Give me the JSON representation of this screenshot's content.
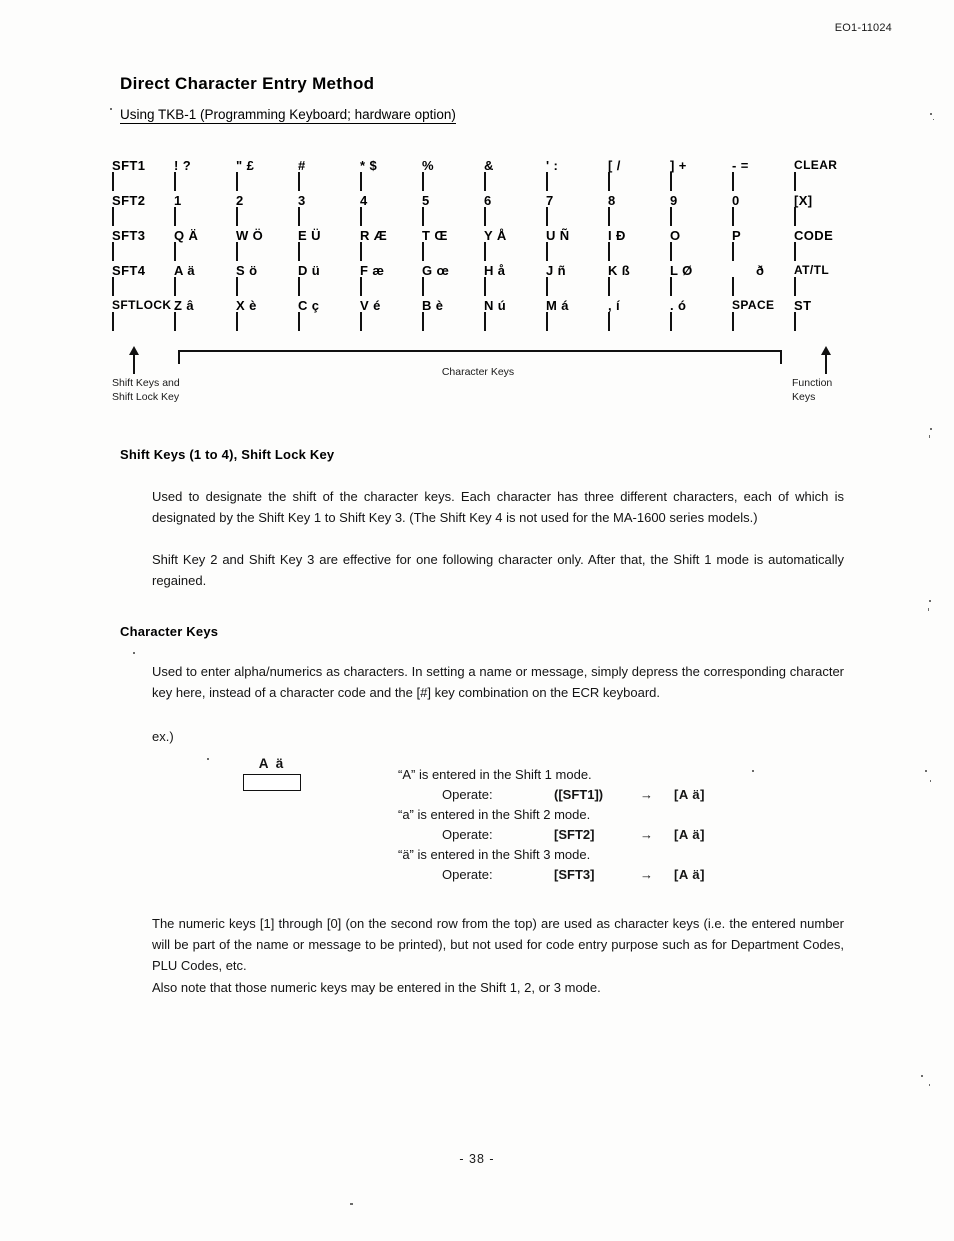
{
  "header": {
    "doc_code": "EO1-11024"
  },
  "titles": {
    "main": "Direct Character Entry Method",
    "sub": "Using TKB-1 (Programming Keyboard; hardware option)"
  },
  "keyboard": {
    "rows": [
      {
        "shift": "SFT1",
        "chars": [
          "! ?",
          "\" £",
          "#",
          "* $",
          "%",
          "&",
          "' :",
          "[ /",
          "] +",
          "- ="
        ],
        "fn": "CLEAR"
      },
      {
        "shift": "SFT2",
        "chars": [
          "1",
          "2",
          "3",
          "4",
          "5",
          "6",
          "7",
          "8",
          "9",
          "0"
        ],
        "fn": "[X]"
      },
      {
        "shift": "SFT3",
        "chars": [
          "Q Ä",
          "W Ö",
          "E Ü",
          "R Æ",
          "T Œ",
          "Y Å",
          "U Ñ",
          "I Ð",
          "O",
          "P"
        ],
        "fn": "CODE"
      },
      {
        "shift": "SFT4",
        "chars": [
          "A ä",
          "S ö",
          "D ü",
          "F æ",
          "G œ",
          "H å",
          "J ñ",
          "K ß",
          "L Ø",
          "ð"
        ],
        "fn": "AT/TL"
      },
      {
        "shift": "SFTLOCK",
        "chars": [
          "Z â",
          "X è",
          "C ç",
          "V é",
          "B è",
          "N ú",
          "M á",
          ", í",
          ". ó",
          "SPACE"
        ],
        "fn": "ST"
      }
    ],
    "annotations": {
      "left": "Shift Keys  and\nShift Lock Key",
      "center": "Character Keys",
      "right": "Function\nKeys"
    }
  },
  "sections": {
    "shift_keys": {
      "heading": "Shift Keys (1 to 4), Shift Lock Key",
      "p1": "Used to designate the shift of the character keys.  Each character has three different characters, each of which is designated by the Shift Key 1 to Shift Key 3.  (The Shift Key 4 is not used for the MA-1600 series models.)",
      "p2": "Shift Key 2 and Shift Key 3 are effective for one following character only.  After that, the Shift 1 mode is automatically regained."
    },
    "character_keys": {
      "heading": "Character Keys",
      "p1": "Used to enter alpha/numerics as characters.  In setting a name or message, simply depress the corresponding character key here, instead of a character code and the [#] key combination on the ECR keyboard.",
      "ex_label": "ex.)",
      "example": {
        "key_cap": "A ä",
        "lines": [
          {
            "desc": "“A” is entered in the Shift 1 mode.",
            "op_label": "Operate:",
            "op_key": "([SFT1])",
            "arrow": "→",
            "result": "[A  ä]"
          },
          {
            "desc": "“a” is entered in the Shift 2 mode.",
            "op_label": "Operate:",
            "op_key": "[SFT2]",
            "arrow": "→",
            "result": "[A  ä]"
          },
          {
            "desc": "“ä” is entered in the Shift 3 mode.",
            "op_label": "Operate:",
            "op_key": "[SFT3]",
            "arrow": "→",
            "result": "[A  ä]"
          }
        ]
      },
      "p2": "The numeric keys [1] through [0] (on the second row from the top) are used as character keys (i.e. the entered number will be part of the name or message to be printed), but not used for code entry purpose such as for Department Codes, PLU Codes, etc.",
      "p3": "Also note that those numeric keys may be entered in the Shift 1, 2, or 3 mode."
    }
  },
  "footer": {
    "page": "- 38 -"
  }
}
